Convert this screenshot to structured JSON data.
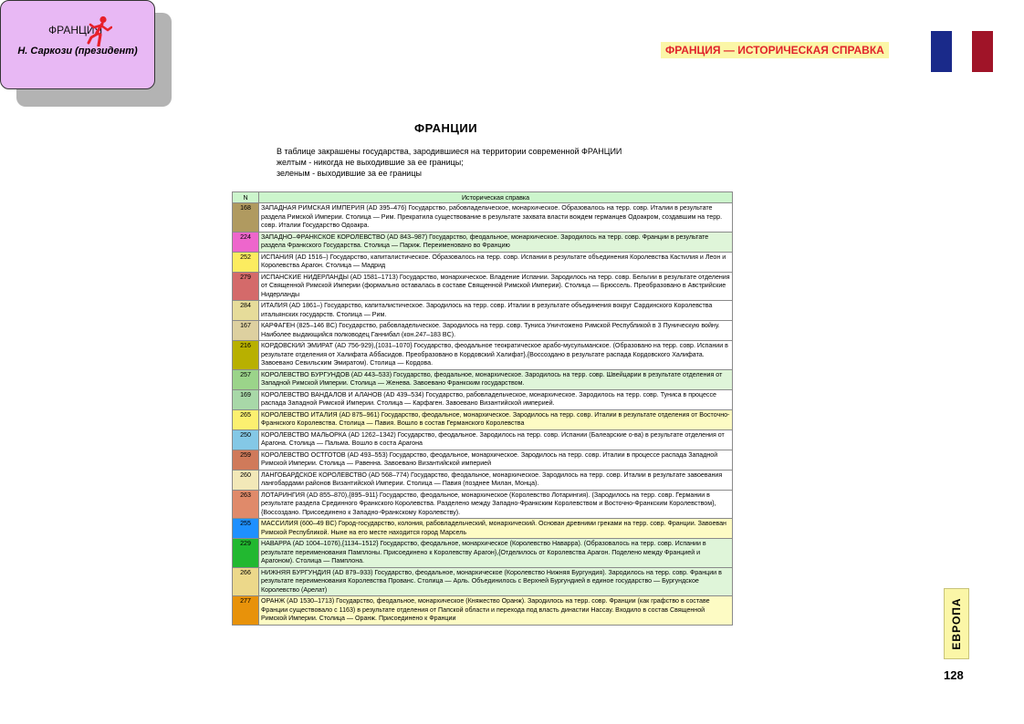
{
  "badge": {
    "country": "ФРАНЦИЯ",
    "president": "Н. Саркози (президент)",
    "icon": "runner-icon"
  },
  "header": {
    "title": "ФРАНЦИЯ — ИСТОРИЧЕСКАЯ СПРАВКА",
    "title_color": "#e0242c",
    "title_bg": "#fbf6a7"
  },
  "flag": {
    "colors": [
      "#1a2a8a",
      "#ffffff",
      "#a01428"
    ]
  },
  "document": {
    "title": "ФРАНЦИИ",
    "intro": [
      "В таблице закрашены государства, зародившиеся на территории современной ФРАНЦИИ",
      "желтым - никогда не выходившие за  ее границы;",
      "зеленым - выходившие за ее границы"
    ]
  },
  "table": {
    "headers": {
      "num": "N",
      "desc": "Историческая справка"
    },
    "rows": [
      {
        "num": "168",
        "color": "#b09a60",
        "bg": "#ffffff",
        "lines": 3,
        "text": "ЗАПАДНАЯ РИМСКАЯ ИМПЕРИЯ  (AD 395–476)     Государство, рабовладельческое, монархическое. Образовалось на  терр. совр. Италии в результате раздела Римской Империи. Столица —  Рим. Прекратила существование в результате захвата власти вождем германцев Одоакром, создавшим на терр. совр. Италии Государство Одоакра."
      },
      {
        "num": "224",
        "color": "#ee66cc",
        "bg": "#dff5d9",
        "lines": 2,
        "text": "ЗАПАДНО–ФРАНКСКОЕ КОРОЛЕВСТВО  (AD 843–987)     Государство, феодальное, монархическое. Зародилось на терр. совр. Франции в результате раздела Франкского Государства. Столица —  Париж. Переименовано во Францию"
      },
      {
        "num": "252",
        "color": "#fcec60",
        "bg": "#ffffff",
        "lines": 2,
        "text": "ИСПАНИЯ  (AD 1516–)     Государство, капиталистическое. Образовалось на терр. совр. Испании в результате объединения Королевства  Кастилия и Леон и Королевства Арагон. Столица —  Мадрид"
      },
      {
        "num": "279",
        "color": "#d46a6a",
        "bg": "#ffffff",
        "lines": 3,
        "text": "ИСПАНСКИЕ НИДЕРЛАНДЫ  (AD 1581–1713)     Государство, монархическое. Владение Испании. Зародилось на терр. совр. Бельгии в результате отделения от Священной Римской Империи (формально оставалась в составе Священной Римской Империи). Столица —  Брюссель. Преобразовано в Австрийские Нидерланды"
      },
      {
        "num": "284",
        "color": "#e6dc9a",
        "bg": "#ffffff",
        "lines": 2,
        "text": "ИТАЛИЯ  (AD 1861–)     Государство, капиталистическое. Зародилось на терр. совр. Италии в результате объединения вокруг Сардинского Королевства итальянских государств. Столица — Рим."
      },
      {
        "num": "167",
        "color": "#ddd0a0",
        "bg": "#ffffff",
        "lines": 2,
        "text": "КАРФАГЕН  (825–146 BC) Государство, рабовладельческое.  Зародилось на терр. совр. Туниса  Уничтожено Римской Республикой в 3 Пуническую войну. Наиболее выдающийся полководец Ганнибал (кон.247–183  BC)."
      },
      {
        "num": "216",
        "color": "#b8b000",
        "bg": "#ffffff",
        "lines": 3,
        "text": "КОРДОВСКИЙ ЭМИРАТ (AD 756-929),{1031–1070}     Государство, феодальное теократическое арабо-мусульманское. (Образовано на терр. совр. Испании в результате отделения от Халифата Аббасидов. Преобразовано в Кордовский Халифат},{Воссоздано в результате распада Кордовского Халифата. Завоевано Севильским Эмиратом).  Столица — Кордова."
      },
      {
        "num": "257",
        "color": "#9bd48a",
        "bg": "#dff5d9",
        "lines": 2,
        "text": "КОРОЛЕВСТВО БУРГУНДОВ (AD 443–533)     Государство, феодальное, монархическое. Зародилось на терр. совр. Швейцарии в результате отделения от Западной Римской Империи. Столица — Женева. Завоевано Франкским государством."
      },
      {
        "num": "169",
        "color": "#a8d8a8",
        "bg": "#ffffff",
        "lines": 2,
        "text": "КОРОЛЕВСТВО ВАНДАЛОВ И АЛАНОВ  (AD 439–534)     Государство, рабовладельческое, монархическое. Зародилось на терр. совр. Туниса в процессе распада Западной Римской Империи. Столица —  Карфаген. Завоевано Византийской империей."
      },
      {
        "num": "265",
        "color": "#fcf070",
        "bg": "#fdfbc4",
        "lines": 2,
        "text": "КОРОЛЕВСТВО ИТАЛИЯ  (AD 875–961)     Государство, феодальное, монархическое. Зародилось на терр. совр. Италии в результате отделения от Восточно-Франкского Королевства. Столица — Павия. Вошло в состав Германского Королевства"
      },
      {
        "num": "250",
        "color": "#84c8e6",
        "bg": "#ffffff",
        "lines": 2,
        "text": "КОРОЛЕВСТВО МАЛЬОРКА (AD 1262–1342)     Государство, феодальное. Зародилось на терр. совр. Испании (Балеарские о-ва) в результате отделения от Арагона. Столица — Пальма. Вошло в соста Арагона"
      },
      {
        "num": "259",
        "color": "#d07a5a",
        "bg": "#ffffff",
        "lines": 2,
        "text": "КОРОЛЕВСТВО ОСТГОТОВ  (AD 493–553)     Государство, феодальное, монархическое. Зародилось на терр. совр. Италии в процессе распада Западной Римской Империи. Столица —  Равенна. Завоевано Византийской империей"
      },
      {
        "num": "260",
        "color": "#f2e8b8",
        "bg": "#ffffff",
        "lines": 2,
        "text": "ЛАНГОБАРДСКОЕ КОРОЛЕВСТВО  (AD 568–774)     Государство, феодальное, монархическое. Зародилось на терр. совр. Италии в результате завоевания  лангобардами районов Византийской Империи. Столица —  Павия (позднее Милан, Монца)."
      },
      {
        "num": "263",
        "color": "#e08a6a",
        "bg": "#ffffff",
        "lines": 3,
        "text": "ЛОТАРИНГИЯ  (AD 855–870),{895–911}     Государство, феодальное, монархическое (Королевство Лотарингия). (Зародилось на терр. совр. Германии в результате раздела Срединного Франкского Королевства. Разделено между Западно-Франкским Королевством и Восточно-Франкским Королевством},{Воссоздано. Присоединено к  Западно-Франкскому Королевству)."
      },
      {
        "num": "255",
        "color": "#1e90ff",
        "bg": "#fdfbc4",
        "lines": 2,
        "text": "МАССИЛИЯ (600–49 BC)     Город-государство, колония, рабовладельческий, монархический. Основан древними греками на терр. совр. Франции.  Завоеван Римской Республикой. Ныне на его месте находится город Марсель"
      },
      {
        "num": "229",
        "color": "#22b830",
        "bg": "#dff5d9",
        "lines": 3,
        "text": "НАВАРРА  (AD 1004–1076),{1134–1512}     Государство, феодальное, монархическое (Королевство Наварра). (Образовалось на терр. совр. Испании в результате переименования Памплоны. Присоединено к Королевству Арагон},{Отделилось от Королевства Арагон. Поделено между Францией и Арагоном). Столица —  Памплона."
      },
      {
        "num": "266",
        "color": "#ecd88a",
        "bg": "#dff5d9",
        "lines": 3,
        "text": "НИЖНЯЯ БУРГУНДИЯ  (AD 879–933)     Государство, феодальное, монархическое (Королевство Нижняя Бургундия). Зародилось на терр. совр. Франции в результате переименования Королевства Прованс. Столица — Арль. Объединилось с Верхней Бургундией в единое государство — Бургундское Королевство (Арелат)"
      },
      {
        "num": "277",
        "color": "#e8920a",
        "bg": "#fdfbc4",
        "lines": 3,
        "text": "ОРАНЖ  (AD 1530–1713)     Государство, феодальное, монархическое (Княжество Оранж). Зародилось на терр. совр. Франции (как графство в составе Франции существовало с 1163) в результате отделения от Папской области и перехода под власть династии Нассау. Входило в состав Священной Римской Империи. Столица — Оранж. Присоединено к  Франции"
      }
    ]
  },
  "side_label": "ЕВРОПА",
  "page_number": "128"
}
